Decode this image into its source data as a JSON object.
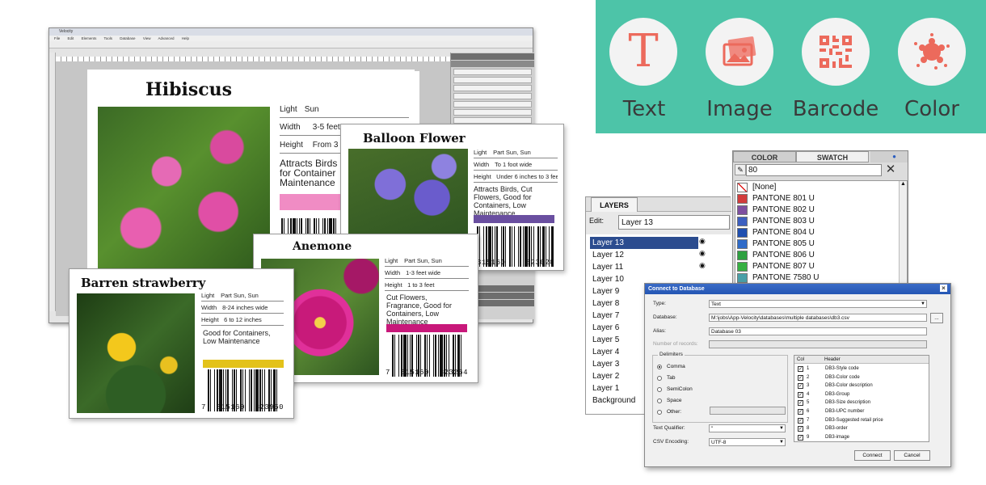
{
  "banner": {
    "bg": "#4dc4a8",
    "features": [
      {
        "label": "Text",
        "icon": "text-icon"
      },
      {
        "label": "Image",
        "icon": "image-icon"
      },
      {
        "label": "Barcode",
        "icon": "qr-code-icon"
      },
      {
        "label": "Color",
        "icon": "paint-splat-icon"
      }
    ]
  },
  "cards": {
    "hibiscus": {
      "title": "Hibiscus",
      "specs": [
        [
          "Light",
          "Sun"
        ],
        [
          "Width",
          "3-5 feet"
        ],
        [
          "Height",
          "From 3"
        ]
      ],
      "description": [
        "Attracts Birds",
        "for Container",
        "Maintenance"
      ],
      "bar_color": "#f08cc4"
    },
    "balloon": {
      "title": "Balloon Flower",
      "specs": [
        [
          "Light",
          "Part Sun, Sun"
        ],
        [
          "Width",
          "To 1 foot wide"
        ],
        [
          "Height",
          "Under 6 inches to 3 feet"
        ]
      ],
      "description": [
        "Attracts Birds, Cut",
        "Flowers, Good for",
        "Containers, Low",
        "Maintenance"
      ],
      "bar_color": "#6a4fa0",
      "barcode": [
        "315160",
        "823028"
      ]
    },
    "anemone": {
      "title": "Anemone",
      "specs": [
        [
          "Light",
          "Part Sun, Sun"
        ],
        [
          "Width",
          "1-3 feet wide"
        ],
        [
          "Height",
          "1 to 3 feet"
        ]
      ],
      "description": [
        "Cut Flowers,",
        "Fragrance, Good for",
        "Containers, Low",
        "Maintenance"
      ],
      "bar_color": "#c8187a",
      "barcode": [
        "7",
        "315160",
        "823264"
      ]
    },
    "barren": {
      "title": "Barren strawberry",
      "specs": [
        [
          "Light",
          "Part Sun, Sun"
        ],
        [
          "Width",
          "8-24 inches wide"
        ],
        [
          "Height",
          "6 to 12 inches"
        ]
      ],
      "description": [
        "Good for Containers,",
        "Low Maintenance"
      ],
      "bar_color": "#e3c21a",
      "barcode": [
        "7",
        "315160",
        "823950"
      ]
    }
  },
  "color_panel": {
    "tabs": [
      "COLOR",
      "SWATCH"
    ],
    "search_value": "80",
    "swatches": [
      {
        "name": "[None]",
        "color": "none"
      },
      {
        "name": "PANTONE 801 U",
        "color": "#d23c3c"
      },
      {
        "name": "PANTONE 802 U",
        "color": "#7e4fa0"
      },
      {
        "name": "PANTONE 803 U",
        "color": "#3c5fc0"
      },
      {
        "name": "PANTONE 804 U",
        "color": "#1f4fb0"
      },
      {
        "name": "PANTONE 805 U",
        "color": "#2f6bc8"
      },
      {
        "name": "PANTONE 806 U",
        "color": "#2ea040"
      },
      {
        "name": "PANTONE 807 U",
        "color": "#36b042"
      },
      {
        "name": "PANTONE 7580 U",
        "color": "#4aa0a8"
      }
    ]
  },
  "layers_panel": {
    "title": "LAYERS",
    "edit_label": "Edit:",
    "edit_value": "Layer 13",
    "layers": [
      "Layer 13",
      "Layer 12",
      "Layer 11",
      "Layer 10",
      "Layer 9",
      "Layer 8",
      "Layer 7",
      "Layer 6",
      "Layer 5",
      "Layer 4",
      "Layer 3",
      "Layer 2",
      "Layer 1",
      "Background"
    ],
    "selected": "Layer 13"
  },
  "db_dialog": {
    "title": "Connect to Database",
    "close": "×",
    "type_label": "Type:",
    "type_value": "Text",
    "database_label": "Database:",
    "database_value": "M:\\jobs\\App-Velocity\\databases\\multiple databases\\db3.csv",
    "browse": "...",
    "alias_label": "Alias:",
    "alias_value": "Database 03",
    "records_label": "Number of records:",
    "delimiters_label": "Delimiters",
    "delimiters": [
      "Comma",
      "Tab",
      "SemiColon",
      "Space",
      "Other:"
    ],
    "delimiter_selected": "Comma",
    "qualifier_label": "Text Qualifier:",
    "qualifier_value": "\"",
    "encoding_label": "CSV Encoding:",
    "encoding_value": "UTF-8",
    "col_header": "Col",
    "header_header": "Header",
    "columns": [
      {
        "col": "1",
        "header": "DB3-Style code"
      },
      {
        "col": "2",
        "header": "DB3-Color code"
      },
      {
        "col": "3",
        "header": "DB3-Color description"
      },
      {
        "col": "4",
        "header": "DB3-Group"
      },
      {
        "col": "5",
        "header": "DB3-Size description"
      },
      {
        "col": "6",
        "header": "DB3-UPC number"
      },
      {
        "col": "7",
        "header": "DB3-Suggested retail price"
      },
      {
        "col": "8",
        "header": "DB3-order"
      },
      {
        "col": "9",
        "header": "DB3-image"
      }
    ],
    "connect": "Connect",
    "cancel": "Cancel"
  },
  "app": {
    "title": "Velocity",
    "menus": [
      "File",
      "Edit",
      "Elements",
      "Tools",
      "Database",
      "View",
      "Advanced",
      "Help"
    ]
  }
}
